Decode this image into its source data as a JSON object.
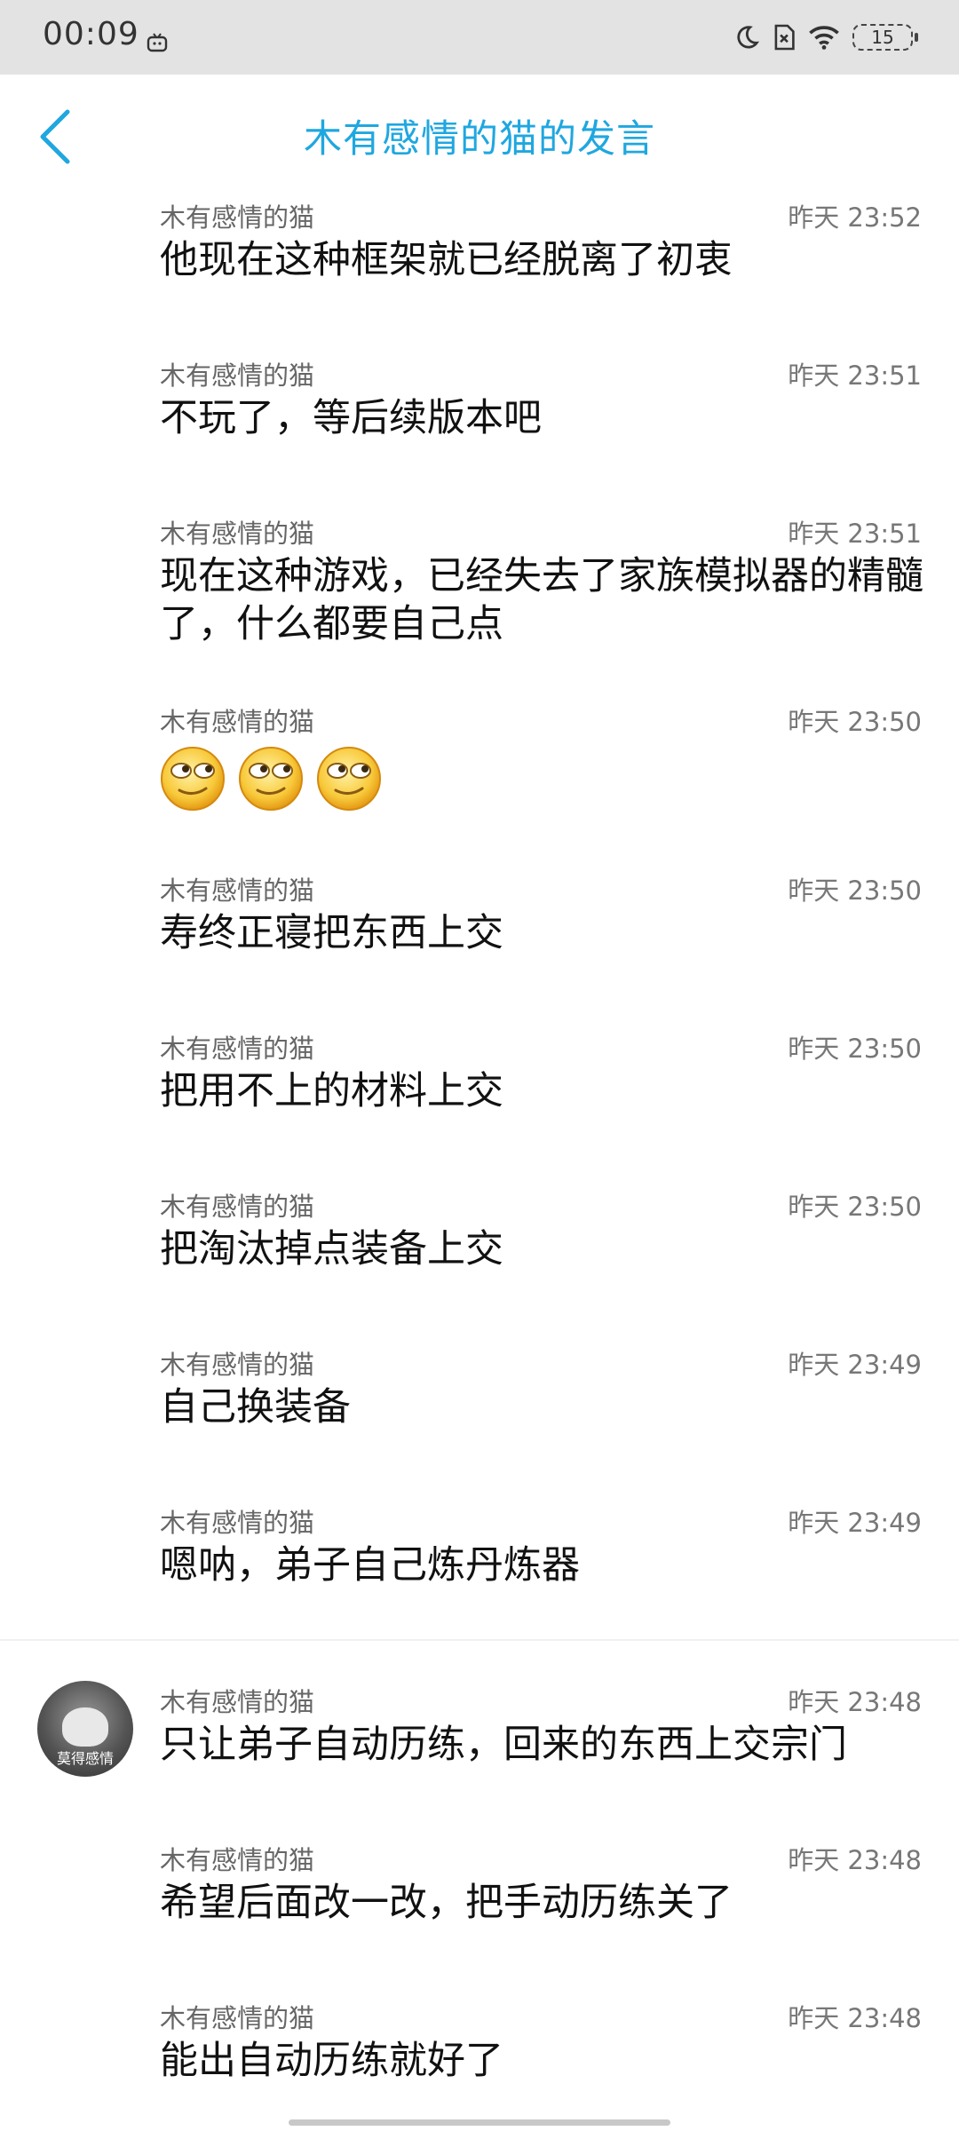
{
  "status_bar": {
    "time": "00:09",
    "battery": "15",
    "icons": [
      "tv-notification-icon",
      "moon-icon",
      "sim-off-icon",
      "wifi-icon",
      "battery-icon"
    ]
  },
  "header": {
    "title": "木有感情的猫的发言",
    "back_icon": "chevron-left-icon",
    "accent_color": "#1fa7e0"
  },
  "messages": [
    {
      "author": "木有感情的猫",
      "time": "昨天 23:52",
      "text": "他现在这种框架就已经脱离了初衷"
    },
    {
      "author": "木有感情的猫",
      "time": "昨天 23:51",
      "text": "不玩了，等后续版本吧"
    },
    {
      "author": "木有感情的猫",
      "time": "昨天 23:51",
      "text": "现在这种游戏，已经失去了家族模拟器的精髓了，什么都要自己点"
    },
    {
      "author": "木有感情的猫",
      "time": "昨天 23:50",
      "text": "",
      "emojis": [
        "smirk-emoji",
        "smirk-emoji",
        "smirk-emoji"
      ]
    },
    {
      "author": "木有感情的猫",
      "time": "昨天 23:50",
      "text": "寿终正寝把东西上交"
    },
    {
      "author": "木有感情的猫",
      "time": "昨天 23:50",
      "text": "把用不上的材料上交"
    },
    {
      "author": "木有感情的猫",
      "time": "昨天 23:50",
      "text": "把淘汰掉点装备上交"
    },
    {
      "author": "木有感情的猫",
      "time": "昨天 23:49",
      "text": "自己换装备"
    },
    {
      "author": "木有感情的猫",
      "time": "昨天 23:49",
      "text": "嗯呐，弟子自己炼丹炼器"
    },
    {
      "author": "木有感情的猫",
      "time": "昨天 23:48",
      "text": "只让弟子自动历练，回来的东西上交宗门",
      "avatar_text": "莫得感情"
    },
    {
      "author": "木有感情的猫",
      "time": "昨天 23:48",
      "text": "希望后面改一改，把手动历练关了"
    },
    {
      "author": "木有感情的猫",
      "time": "昨天 23:48",
      "text": "能出自动历练就好了"
    }
  ]
}
